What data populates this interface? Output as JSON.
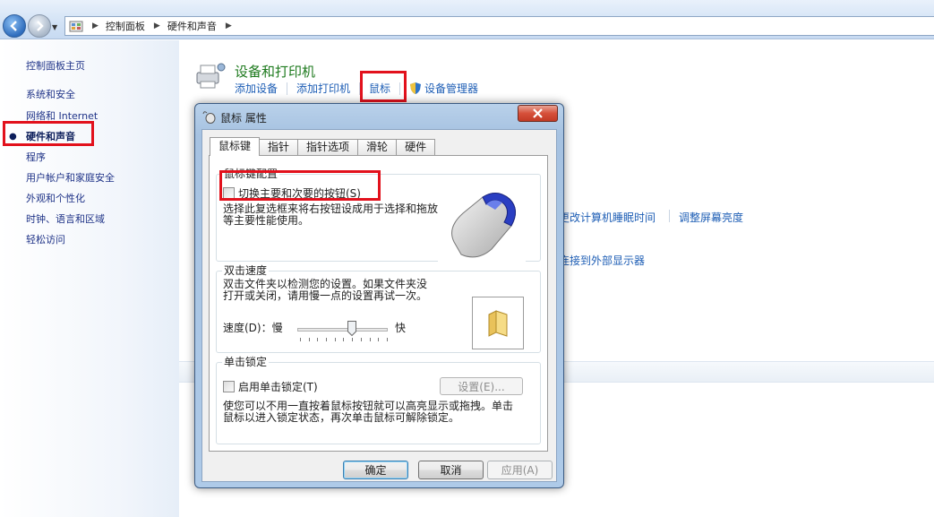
{
  "address_bar": {
    "crumbs": [
      "控制面板",
      "硬件和声音"
    ]
  },
  "left_nav": {
    "items": [
      {
        "label": "控制面板主页"
      },
      {
        "label": "系统和安全"
      },
      {
        "label": "网络和 Internet"
      },
      {
        "label": "硬件和声音",
        "current": true
      },
      {
        "label": "程序"
      },
      {
        "label": "用户帐户和家庭安全"
      },
      {
        "label": "外观和个性化"
      },
      {
        "label": "时钟、语言和区域"
      },
      {
        "label": "轻松访问"
      }
    ]
  },
  "main": {
    "section_title": "设备和打印机",
    "links": {
      "add_device": "添加设备",
      "add_printer": "添加打印机",
      "mouse": "鼠标",
      "device_manager": "设备管理器"
    },
    "partial_links": {
      "sleep_time": "更改计算机睡眠时间",
      "brightness": "调整屏幕亮度",
      "external_display": "连接到外部显示器"
    }
  },
  "dialog": {
    "title": "鼠标 属性",
    "tabs": [
      "鼠标键",
      "指针",
      "指针选项",
      "滑轮",
      "硬件"
    ],
    "active_tab": "鼠标键",
    "button_config": {
      "group_title": "鼠标键配置",
      "checkbox_label": "切换主要和次要的按钮(S)",
      "checked": false,
      "description_line1": "选择此复选框来将右按钮设成用于选择和拖放",
      "description_line2": "等主要性能使用。"
    },
    "double_click": {
      "group_title": "双击速度",
      "description_line1": "双击文件夹以检测您的设置。如果文件夹没",
      "description_line2": "打开或关闭，请用慢一点的设置再试一次。",
      "speed_label": "速度(D)：慢",
      "fast_label": "快",
      "speed_level_fraction": 0.62
    },
    "click_lock": {
      "group_title": "单击锁定",
      "checkbox_label": "启用单击锁定(T)",
      "checked": false,
      "settings_button": "设置(E)...",
      "description_line1": "使您可以不用一直按着鼠标按钮就可以高亮显示或拖拽。单击",
      "description_line2": "鼠标以进入锁定状态，再次单击鼠标可解除锁定。"
    },
    "buttons": {
      "ok": "确定",
      "cancel": "取消",
      "apply": "应用(A)"
    }
  },
  "colors": {
    "highlight_box": "#e2111c",
    "link": "#1e5eb5",
    "section_title": "#1e7a1e"
  }
}
